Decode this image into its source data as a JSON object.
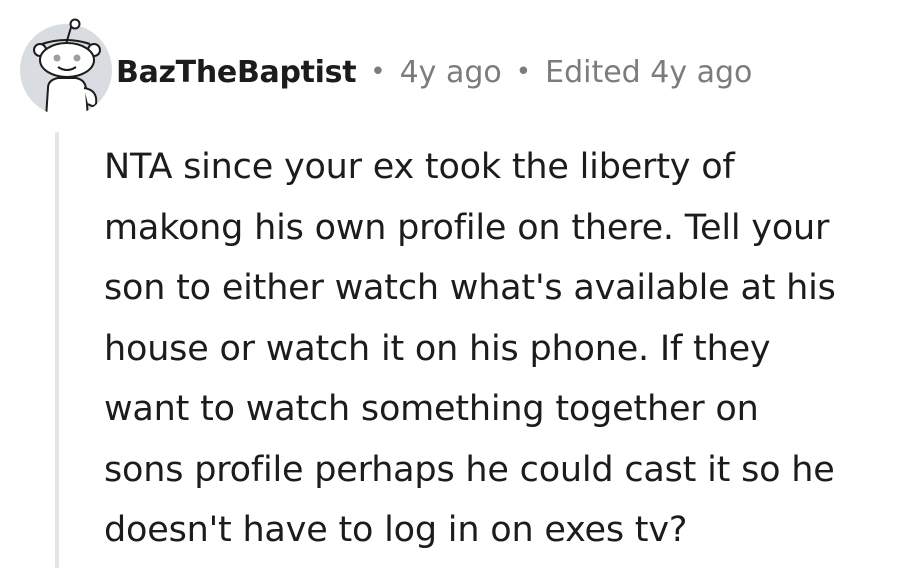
{
  "comment": {
    "author": "BazTheBaptist",
    "separator": "•",
    "timestamp": "4y ago",
    "edited": "Edited 4y ago",
    "avatar_icon": "snoo-avatar-icon",
    "lines": [
      "NTA since your ex took the liberty of",
      "makong his own profile on there. Tell your",
      "son to either watch what's available at his",
      "house or watch it on his phone. If they",
      "want to watch something together on",
      "sons profile perhaps he could cast it so he",
      "doesn't have to log in on exes tv?"
    ]
  },
  "colors": {
    "text": "#1c1c1c",
    "meta": "#7c7c7c",
    "thread_line": "#e5e5e5",
    "avatar_bg": "#d9dde2"
  }
}
